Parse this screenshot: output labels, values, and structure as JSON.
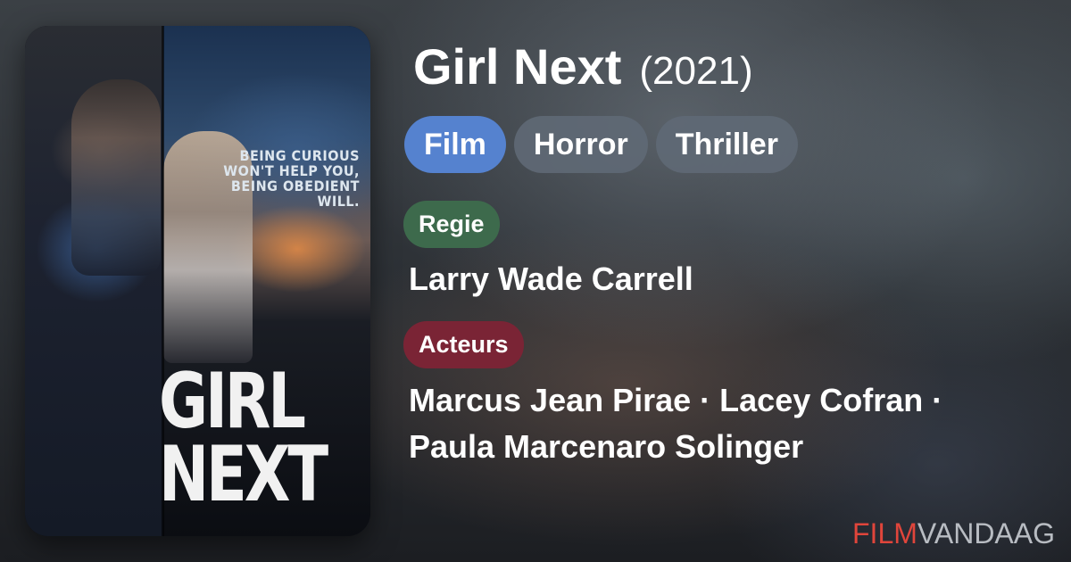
{
  "poster": {
    "tagline_lines": [
      "BEING CURIOUS",
      "WON'T HELP YOU,",
      "BEING OBEDIENT",
      "WILL."
    ],
    "title_lines": [
      "GIRL",
      "NEXT"
    ]
  },
  "movie": {
    "title": "Girl Next",
    "year": "(2021)"
  },
  "genres": [
    "Film",
    "Horror",
    "Thriller"
  ],
  "director": {
    "label": "Regie",
    "name": "Larry Wade Carrell"
  },
  "cast": {
    "label": "Acteurs",
    "line1": "Marcus Jean Pirae · Lacey Cofran ·",
    "line2": "Paula Marcenaro Solinger"
  },
  "brand": {
    "part1": "FILM",
    "part2": "VANDAAG"
  },
  "colors": {
    "film_pill": "#5582cf",
    "regie_label": "#3d6a4c",
    "acteurs_label": "#7a2435",
    "brand_accent": "#e0453b"
  }
}
